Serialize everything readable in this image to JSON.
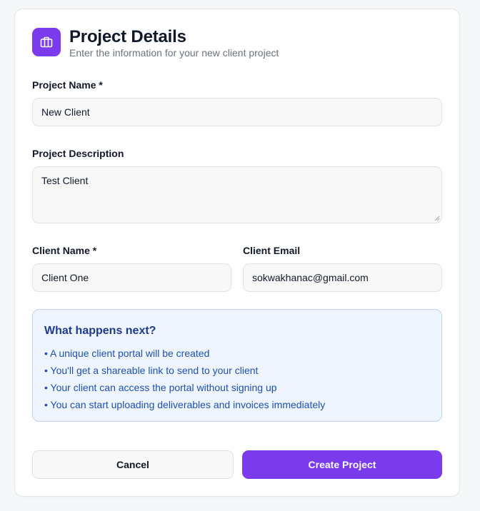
{
  "header": {
    "title": "Project Details",
    "subtitle": "Enter the information for your new client project",
    "icon": "briefcase-icon"
  },
  "form": {
    "project_name": {
      "label": "Project Name *",
      "value": "New Client"
    },
    "project_description": {
      "label": "Project Description",
      "value": "Test Client"
    },
    "client_name": {
      "label": "Client Name *",
      "value": "Client One"
    },
    "client_email": {
      "label": "Client Email",
      "value": "sokwakhanac@gmail.com"
    }
  },
  "info": {
    "title": "What happens next?",
    "items": [
      "• A unique client portal will be created",
      "• You'll get a shareable link to send to your client",
      "• Your client can access the portal without signing up",
      "• You can start uploading deliverables and invoices immediately"
    ]
  },
  "actions": {
    "cancel_label": "Cancel",
    "create_label": "Create Project"
  },
  "colors": {
    "accent": "#7c3aed",
    "info_bg": "#eef5ff",
    "info_border": "#bcd4f2",
    "info_text": "#1e4fb0"
  }
}
